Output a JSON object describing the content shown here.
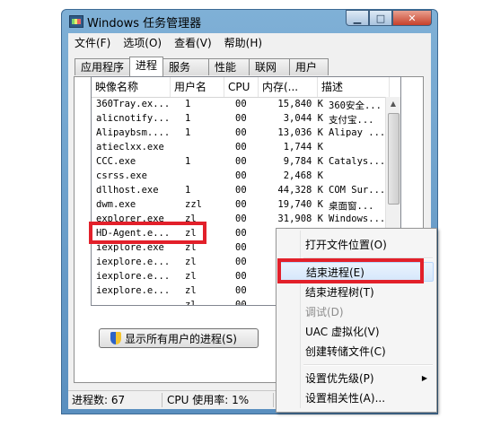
{
  "window": {
    "title": "Windows 任务管理器"
  },
  "menubar": [
    "文件(F)",
    "选项(O)",
    "查看(V)",
    "帮助(H)"
  ],
  "tabs": [
    "应用程序",
    "进程",
    "服务",
    "性能",
    "联网",
    "用户"
  ],
  "active_tab": "进程",
  "columns": [
    "映像名称",
    "用户名",
    "CPU",
    "内存(...",
    "描述"
  ],
  "processes": [
    {
      "name": "360Tray.ex...",
      "user": "1",
      "cpu": "00",
      "mem": "15,840 K",
      "desc": "360安全..."
    },
    {
      "name": "alicnotify...",
      "user": "1",
      "cpu": "00",
      "mem": "3,044 K",
      "desc": "支付宝..."
    },
    {
      "name": "Alipaybsm....",
      "user": "1",
      "cpu": "00",
      "mem": "13,036 K",
      "desc": "Alipay ..."
    },
    {
      "name": "atieclxx.exe",
      "user": "",
      "cpu": "00",
      "mem": "1,744 K",
      "desc": ""
    },
    {
      "name": "CCC.exe",
      "user": "1",
      "cpu": "00",
      "mem": "9,784 K",
      "desc": "Catalys..."
    },
    {
      "name": "csrss.exe",
      "user": "",
      "cpu": "00",
      "mem": "2,468 K",
      "desc": ""
    },
    {
      "name": "dllhost.exe",
      "user": "1",
      "cpu": "00",
      "mem": "44,328 K",
      "desc": "COM Sur..."
    },
    {
      "name": "dwm.exe",
      "user": "zzl",
      "cpu": "00",
      "mem": "19,740 K",
      "desc": "桌面窗..."
    },
    {
      "name": "explorer.exe",
      "user": "zl",
      "cpu": "00",
      "mem": "31,908 K",
      "desc": "Windows..."
    },
    {
      "name": "HD-Agent.e...",
      "user": "zl",
      "cpu": "00",
      "mem": "",
      "desc": ""
    },
    {
      "name": "iexplore.exe",
      "user": "zl",
      "cpu": "00",
      "mem": "1",
      "desc": ""
    },
    {
      "name": "iexplore.e...",
      "user": "zl",
      "cpu": "00",
      "mem": "7",
      "desc": ""
    },
    {
      "name": "iexplore.e...",
      "user": "zl",
      "cpu": "00",
      "mem": "7",
      "desc": ""
    },
    {
      "name": "iexplore.e...",
      "user": "zl",
      "cpu": "00",
      "mem": "9",
      "desc": ""
    },
    {
      "name": "",
      "user": "zl",
      "cpu": "00",
      "mem": "",
      "desc": ""
    }
  ],
  "show_all_button": "显示所有用户的进程(S)",
  "status": {
    "processes": "进程数: 67",
    "cpu": "CPU 使用率: 1%"
  },
  "context_menu": [
    {
      "label": "打开文件位置(O)",
      "state": "normal"
    },
    {
      "label": "结束进程(E)",
      "state": "hover"
    },
    {
      "label": "结束进程树(T)",
      "state": "normal"
    },
    {
      "label": "调试(D)",
      "state": "disabled"
    },
    {
      "label": "UAC 虚拟化(V)",
      "state": "normal"
    },
    {
      "label": "创建转储文件(C)",
      "state": "normal"
    },
    {
      "label": "设置优先级(P)",
      "state": "submenu"
    },
    {
      "label": "设置相关性(A)...",
      "state": "normal"
    }
  ],
  "colors": {
    "highlight_box": "#e2202a",
    "menu_hover": "#d5e7fb"
  }
}
